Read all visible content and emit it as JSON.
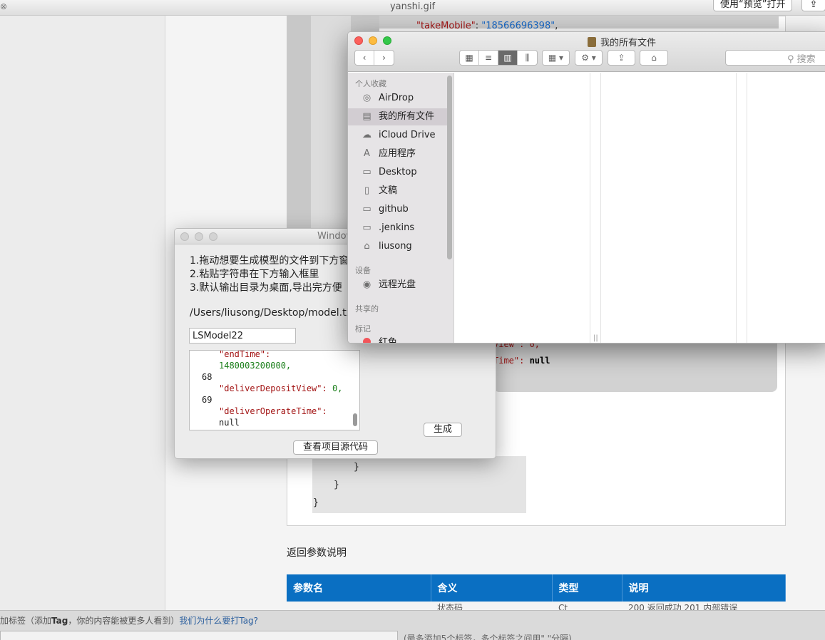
{
  "preview": {
    "title": "yanshi.gif",
    "open_button": "使用“预览”打开",
    "share_icon": "share-icon"
  },
  "code": {
    "top_key": "\"takeMobile\"",
    "top_value": "\"18566696398\"",
    "frag1": "View\": 0,",
    "frag2_pre": "Time\": ",
    "frag2_val": "null"
  },
  "return_section": {
    "title": "返回参数说明",
    "headers": [
      "参数名",
      "含义",
      "类型",
      "说明"
    ],
    "row_fragment": [
      "",
      "状态码",
      "Ct",
      "200 返回成功 201 内部错误"
    ]
  },
  "tag_bar": {
    "prefix": "加标签（添加",
    "bold": "Tag",
    "suffix": "，你的内容能被更多人看到）",
    "link": "我们为什么要打Tag?",
    "hint": "(最多添加5个标签，多个标签之间用\",\"分隔)"
  },
  "generator": {
    "title": "Window",
    "instructions": [
      "1.拖动想要生成模型的文件到下方窗",
      "2.粘贴字符串在下方输入框里",
      "3.默认输出目录为桌面,导出完方便"
    ],
    "path": "/Users/liusong/Desktop/model.txt",
    "model_name": "LSModel22",
    "json_lines": {
      "l1_key": "\"endTime\":",
      "l2_val": "1480003200000,",
      "l3_no": "68",
      "l4_key": "\"deliverDepositView\":",
      "l4_val": "0,",
      "l5_no": "69",
      "l6_key": "\"deliverOperateTime\":",
      "l7_val": "null"
    },
    "generate_button": "生成",
    "source_button": "查看项目源代码"
  },
  "finder": {
    "title": "我的所有文件",
    "search_placeholder": "搜索",
    "sections": {
      "favorites": "个人收藏",
      "devices": "设备",
      "shared": "共享的",
      "tags": "标记"
    },
    "favorites": [
      {
        "label": "AirDrop",
        "icon": "airdrop-icon"
      },
      {
        "label": "我的所有文件",
        "icon": "all-files-icon",
        "selected": true
      },
      {
        "label": "iCloud Drive",
        "icon": "cloud-icon"
      },
      {
        "label": "应用程序",
        "icon": "applications-icon"
      },
      {
        "label": "Desktop",
        "icon": "desktop-icon"
      },
      {
        "label": "文稿",
        "icon": "document-icon"
      },
      {
        "label": "github",
        "icon": "folder-icon"
      },
      {
        "label": ".jenkins",
        "icon": "folder-icon"
      },
      {
        "label": "liusong",
        "icon": "home-icon"
      }
    ],
    "devices": [
      {
        "label": "远程光盘",
        "icon": "disc-icon"
      }
    ],
    "tags": [
      {
        "label": "红色",
        "color": "#f2555a"
      }
    ]
  }
}
